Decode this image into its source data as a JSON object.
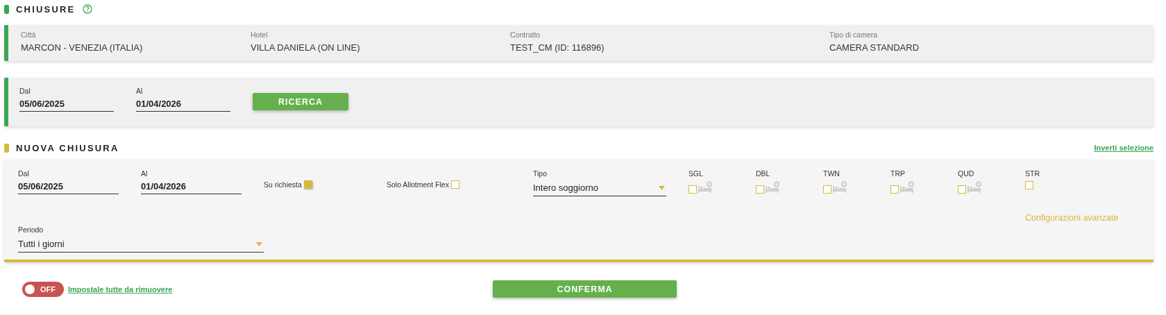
{
  "section_title": "CHIUSURE",
  "summary": [
    {
      "label": "Città",
      "value": "MARCON - VENEZIA (ITALIA)"
    },
    {
      "label": "Hotel",
      "value": "VILLA DANIELA (ON LINE)"
    },
    {
      "label": "Contratto",
      "value": "TEST_CM (ID: 116896)"
    },
    {
      "label": "Tipo di camera",
      "value": "CAMERA STANDARD"
    }
  ],
  "search": {
    "from": {
      "label": "Dal",
      "value": "05/06/2025"
    },
    "to": {
      "label": "Al",
      "value": "01/04/2026"
    },
    "button": "RICERCA"
  },
  "new_closure": {
    "title": "NUOVA CHIUSURA",
    "invert_link": "Inverti selezione",
    "from": {
      "label": "Dal",
      "value": "05/06/2025"
    },
    "to": {
      "label": "Al",
      "value": "01/04/2026"
    },
    "on_request": {
      "label": "Su richiesta",
      "checked": true
    },
    "allotment_flex": {
      "label": "Solo Allotment Flex",
      "checked": false
    },
    "type": {
      "label": "Tipo",
      "value": "Intero soggiorno"
    },
    "rooms": [
      {
        "label": "SGL",
        "checked": false,
        "kind": "with_add"
      },
      {
        "label": "DBL",
        "checked": false,
        "kind": "with_add"
      },
      {
        "label": "TWN",
        "checked": false,
        "kind": "with_add"
      },
      {
        "label": "TRP",
        "checked": false,
        "kind": "with_add"
      },
      {
        "label": "QUD",
        "checked": false,
        "kind": "with_add"
      },
      {
        "label": "STR",
        "checked": false,
        "kind": "plain"
      }
    ],
    "advanced_link": "Configurazioni avanzate",
    "period": {
      "label": "Periodo",
      "value": "Tutti i giorni"
    }
  },
  "remove_all": {
    "toggle": {
      "on": false,
      "text": "OFF"
    },
    "link": "Impostale tutte da rimuovere"
  },
  "confirm_button": "CONFERMA"
}
